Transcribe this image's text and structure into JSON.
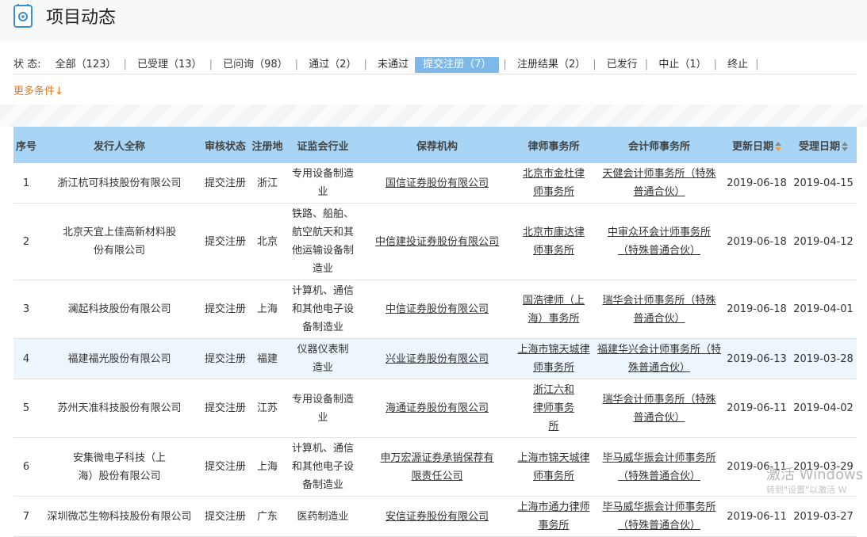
{
  "header": {
    "title": "项目动态"
  },
  "filters": {
    "label": "状  态:",
    "items": [
      {
        "label": "全部（123）"
      },
      {
        "label": "已受理（13）"
      },
      {
        "label": "已问询（98）"
      },
      {
        "label": "通过（2）"
      },
      {
        "label": "未通过"
      },
      {
        "label": "提交注册（7）"
      },
      {
        "label": "注册结果（2）"
      },
      {
        "label": "已发行"
      },
      {
        "label": "中止（1）"
      },
      {
        "label": "终止"
      }
    ],
    "more": "更多条件↓"
  },
  "table": {
    "headers": [
      "序号",
      "发行人全称",
      "审核状态",
      "注册地",
      "证监会行业",
      "保荐机构",
      "律师事务所",
      "会计师事务所",
      "更新日期",
      "受理日期"
    ],
    "rows": [
      [
        "1",
        "浙江杭可科技股份有限公司",
        "提交注册",
        "浙江",
        "专用设备制造业",
        "国信证券股份有限公司",
        "北京市金杜律师事务所",
        "天健会计师事务所（特殊普通合伙）",
        "2019-06-18",
        "2019-04-15"
      ],
      [
        "2",
        "北京天宜上佳高新材料股份有限公司",
        "提交注册",
        "北京",
        "铁路、船舶、航空航天和其他运输设备制造业",
        "中信建投证券股份有限公司",
        "北京市康达律师事务所",
        "中审众环会计师事务所（特殊普通合伙）",
        "2019-06-18",
        "2019-04-12"
      ],
      [
        "3",
        "澜起科技股份有限公司",
        "提交注册",
        "上海",
        "计算机、通信和其他电子设备制造业",
        "中信证券股份有限公司",
        "国浩律师（上海）事务所",
        "瑞华会计师事务所（特殊普通合伙）",
        "2019-06-18",
        "2019-04-01"
      ],
      [
        "4",
        "福建福光股份有限公司",
        "提交注册",
        "福建",
        "仪器仪表制造业",
        "兴业证券股份有限公司",
        "上海市锦天城律师事务所",
        "福建华兴会计师事务所（特殊普通合伙）",
        "2019-06-13",
        "2019-03-28"
      ],
      [
        "5",
        "苏州天准科技股份有限公司",
        "提交注册",
        "江苏",
        "专用设备制造业",
        "海通证券股份有限公司",
        "浙江六和律师事务所",
        "瑞华会计师事务所（特殊普通合伙）",
        "2019-06-11",
        "2019-04-02"
      ],
      [
        "6",
        "安集微电子科技（上海）股份有限公司",
        "提交注册",
        "上海",
        "计算机、通信和其他电子设备制造业",
        "申万宏源证券承销保荐有限责任公司",
        "上海市锦天城律师事务所",
        "毕马威华振会计师事务所（特殊普通合伙）",
        "2019-06-11",
        "2019-03-29"
      ],
      [
        "7",
        "深圳微芯生物科技股份有限公司",
        "提交注册",
        "广东",
        "医药制造业",
        "安信证券股份有限公司",
        "上海市通力律师事务所",
        "毕马威华振会计师事务所（特殊普通合伙）",
        "2019-06-11",
        "2019-03-27"
      ]
    ]
  },
  "watermark": {
    "line1": "激活 Windows",
    "line2": "转到\"设置\"以激活 W"
  },
  "colors": {
    "active_filter": "#7db8e8",
    "table_header": "#a8d5f5",
    "more_link": "#e07a1a"
  }
}
